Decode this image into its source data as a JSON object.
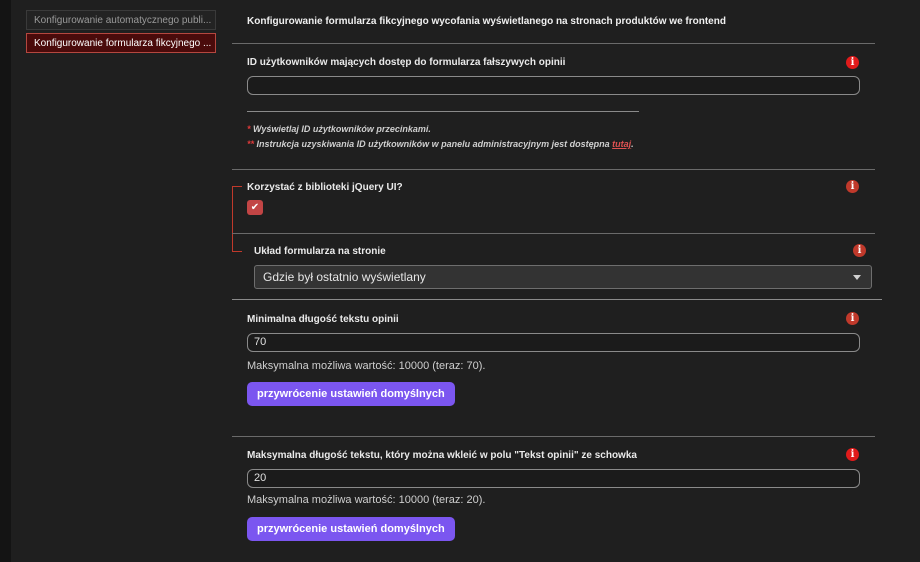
{
  "sidebar": {
    "items": [
      {
        "label": "Konfigurowanie automatycznego publi..."
      },
      {
        "label": "Konfigurowanie formularza fikcyjnego ..."
      }
    ]
  },
  "main": {
    "title": "Konfigurowanie formularza fikcyjnego wycofania wyświetlanego na stronach produktów we frontend",
    "user_ids": {
      "label": "ID użytkowników mających dostęp do formularza fałszywych opinii",
      "value": "",
      "note1": "Wyświetlaj ID użytkowników przecinkami.",
      "note2_prefix": "Instrukcja uzyskiwania ID użytkowników w panelu administracyjnym jest dostępna",
      "note2_link": "tutaj",
      "star1": "*",
      "star2": "**"
    },
    "jquery_ui": {
      "label": "Korzystać z biblioteki jQuery UI?",
      "checked": true,
      "check_glyph": "✔"
    },
    "layout": {
      "label": "Układ formularza na stronie",
      "selected": "Gdzie był ostatnio wyświetlany"
    },
    "min_length": {
      "label": "Minimalna długość tekstu opinii",
      "value": "70",
      "help": "Maksymalna możliwa wartość: 10000 (teraz: 70).",
      "reset_label": "przywrócenie ustawień domyślnych"
    },
    "max_paste": {
      "label": "Maksymalna długość tekstu, który można wkleić w polu \"Tekst opinii\" ze schowka",
      "value": "20",
      "help": "Maksymalna możliwa wartość: 10000 (teraz: 20).",
      "reset_label": "przywrócenie ustawień domyślnych"
    }
  },
  "icons": {
    "info": "i",
    "info_color": "#e01b1b",
    "accent": "#7b56f0"
  }
}
